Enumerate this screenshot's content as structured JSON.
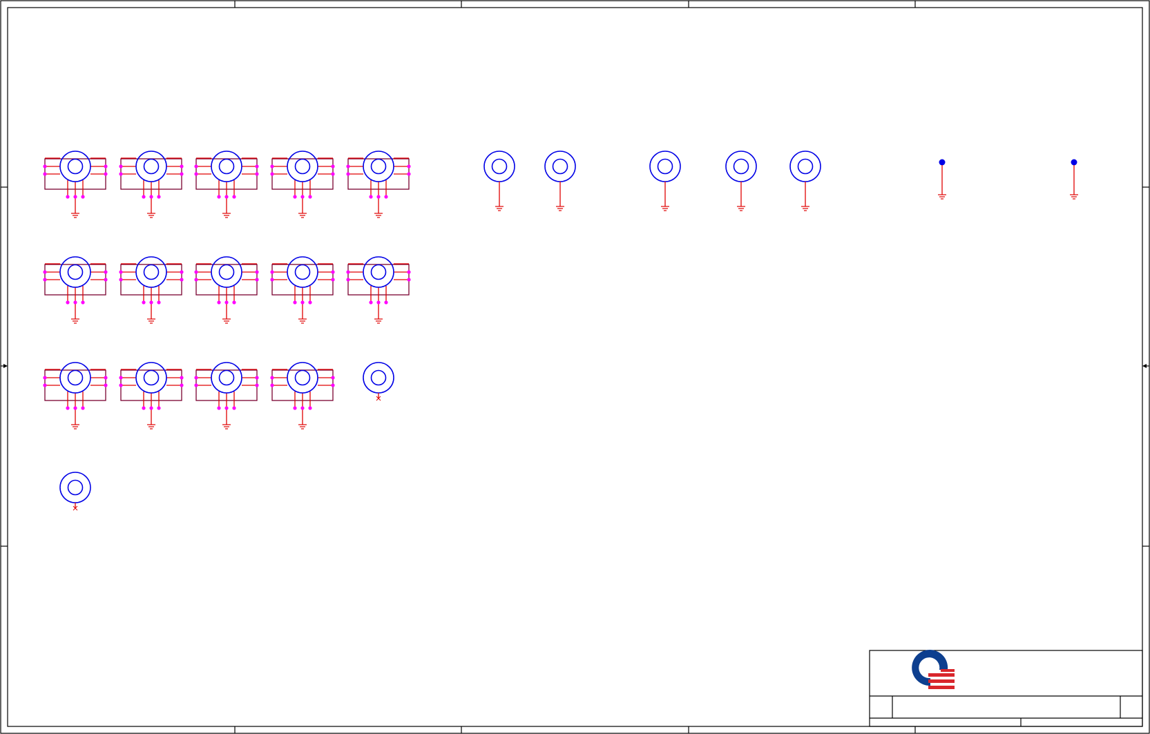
{
  "sheet": {
    "border_color": "#000000",
    "wire_color": "#e00000",
    "pin_color": "#ff00ff",
    "symbol_color": "#0000e6"
  },
  "shielded_connectors": {
    "count": 14,
    "pins_per_part": 7,
    "ground_symbol": "ground-icon"
  },
  "unshielded_connectors": {
    "count": 2,
    "pin_state": "no-connect"
  },
  "grounded_test_points": {
    "count": 5
  },
  "fiducials": {
    "count": 2
  },
  "title_block": {
    "logo": "company-logo",
    "logo_colors": [
      "#0d3f8f",
      "#d9262c"
    ],
    "title": "",
    "size": "",
    "document_number": "",
    "revision": "",
    "date": "",
    "sheet_number": ""
  }
}
